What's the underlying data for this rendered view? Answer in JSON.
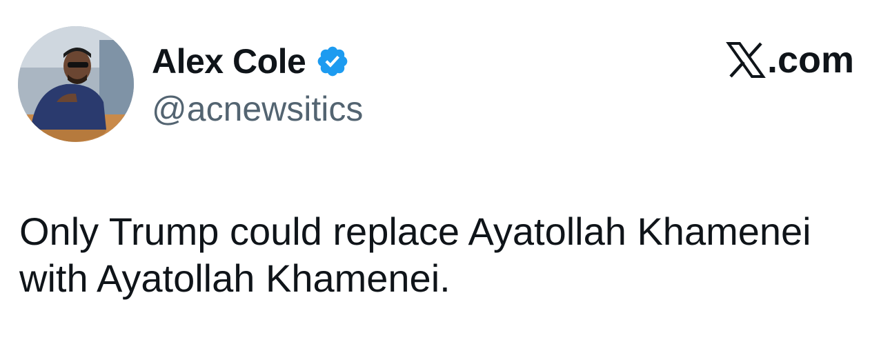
{
  "author": {
    "display_name": "Alex Cole",
    "handle": "@acnewsitics",
    "verified": true,
    "avatar_icon": "avatar-photo"
  },
  "brand": {
    "domain_label": ".com",
    "logo_icon": "x-logo-icon"
  },
  "tweet": {
    "text": "Only Trump could replace Ayatollah Khamenei with Ayatollah Khamenei."
  },
  "colors": {
    "text_primary": "#0f1419",
    "text_secondary": "#536471",
    "verified_blue": "#1d9bf0",
    "background": "#ffffff"
  }
}
